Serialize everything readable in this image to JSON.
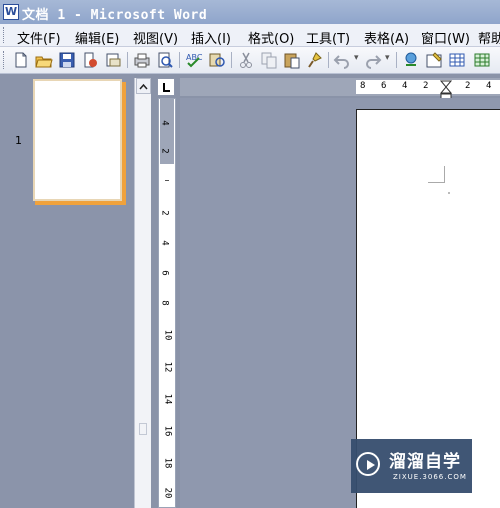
{
  "window": {
    "title": "文档 1 - Microsoft Word",
    "app_icon": "word-doc-icon"
  },
  "menu": [
    {
      "label": "文件(F)"
    },
    {
      "label": "编辑(E)"
    },
    {
      "label": "视图(V)"
    },
    {
      "label": "插入(I)"
    },
    {
      "label": "格式(O)"
    },
    {
      "label": "工具(T)"
    },
    {
      "label": "表格(A)"
    },
    {
      "label": "窗口(W)"
    },
    {
      "label": "帮助"
    }
  ],
  "toolbar": {
    "buttons": [
      "new-document-icon",
      "open-folder-icon",
      "save-icon",
      "permission-icon",
      "email-icon",
      "print-icon",
      "print-preview-icon",
      "spelling-icon",
      "research-icon",
      "cut-icon",
      "copy-icon",
      "paste-icon",
      "format-painter-icon",
      "undo-icon",
      "redo-icon",
      "hyperlink-icon",
      "tables-borders-icon",
      "insert-table-icon",
      "insert-excel-icon"
    ]
  },
  "thumbnails": {
    "page_number": "1"
  },
  "ruler": {
    "tab_selector": "L",
    "horizontal_labels": [
      "8",
      "6",
      "4",
      "2",
      "2",
      "4"
    ],
    "vertical_labels": [
      "4",
      "2",
      "2",
      "4",
      "6",
      "8",
      "10",
      "12",
      "14",
      "16",
      "18",
      "20"
    ]
  },
  "watermark": {
    "title": "溜溜自学",
    "url": "ZIXUE.3066.COM"
  }
}
